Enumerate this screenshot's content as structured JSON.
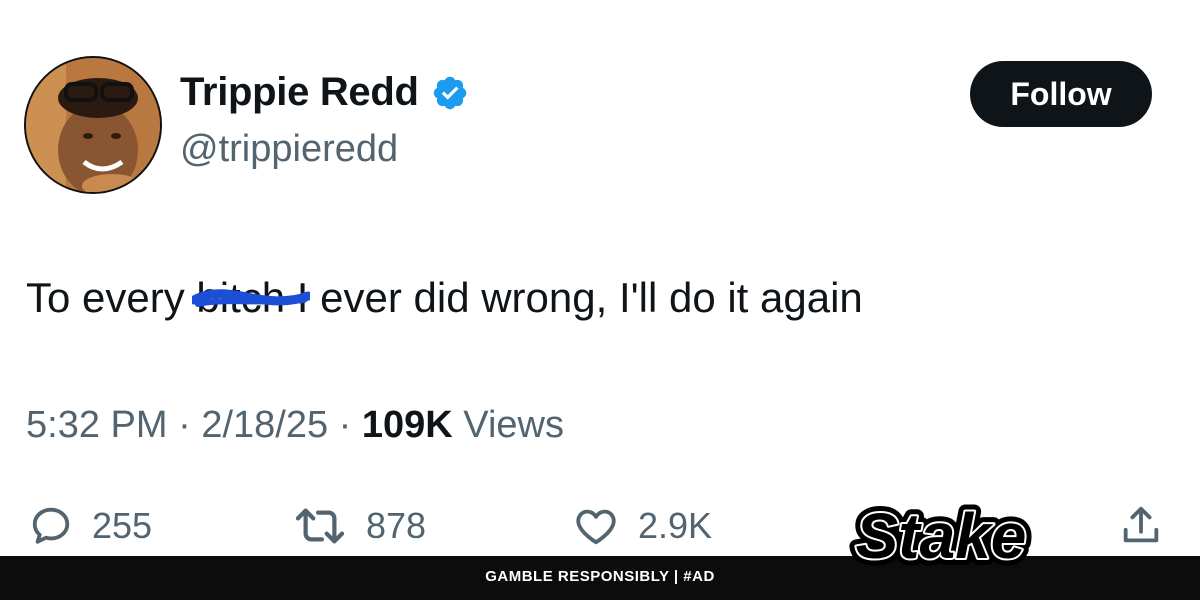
{
  "user": {
    "display_name": "Trippie Redd",
    "handle": "@trippieredd",
    "verified": true,
    "avatar_icon": "profile-photo"
  },
  "follow_button": {
    "label": "Follow"
  },
  "tweet": {
    "text_before": "To every ",
    "censored_word": "bitch",
    "text_after": " I ever did wrong, I'll do it again",
    "censor_color": "#1d4fd6"
  },
  "meta": {
    "time": "5:32 PM",
    "sep1": " · ",
    "date": "2/18/25",
    "sep2": " · ",
    "views_count": "109K",
    "views_label": " Views"
  },
  "actions": {
    "replies": "255",
    "reposts": "878",
    "likes": "2.9K",
    "icons": [
      "reply-icon",
      "repost-icon",
      "like-icon",
      "share-icon"
    ]
  },
  "ad": {
    "text": "GAMBLE RESPONSIBLY  |  #AD",
    "logo_text": "Stake"
  },
  "colors": {
    "verified_blue": "#1d9bf0",
    "text_primary": "#0f1419",
    "text_secondary": "#536471",
    "ad_bar": "#0c0c0c"
  }
}
